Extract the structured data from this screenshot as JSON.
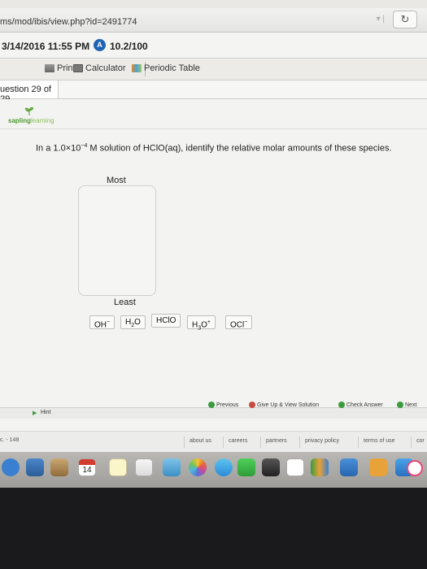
{
  "browser": {
    "url": "ms/mod/ibis/view.php?id=2491774",
    "reload_icon": "reload-icon"
  },
  "status": {
    "datetime": "3/14/2016 11:55 PM",
    "score_icon_letter": "A",
    "score": "10.2/100"
  },
  "toolbar": {
    "print_label": "Print",
    "calculator_label": "Calculator",
    "periodic_table_label": "Periodic Table"
  },
  "question_nav": {
    "label": "uestion 29 of 29"
  },
  "logo": {
    "brand": "sapling",
    "suffix": "learning"
  },
  "question": {
    "prefix": "In a 1.0×10",
    "exponent": "−4",
    "suffix": " M solution of HClO(aq), identify the relative molar amounts of these species."
  },
  "ranking": {
    "most_label": "Most",
    "least_label": "Least"
  },
  "species": [
    {
      "base": "OH",
      "sub": "",
      "sup": "−"
    },
    {
      "base": "H",
      "sub": "2",
      "sup": "",
      "tail": "O"
    },
    {
      "base": "HClO",
      "sub": "",
      "sup": ""
    },
    {
      "base": "H",
      "sub": "3",
      "sup": "+",
      "tail": "O"
    },
    {
      "base": "OCl",
      "sub": "",
      "sup": "−"
    }
  ],
  "actions": {
    "previous": "Previous",
    "give_up": "Give Up & View Solution",
    "check_answer": "Check Answer",
    "next": "Next"
  },
  "hint": {
    "label": "Hint"
  },
  "footer": {
    "left_text": "c. - 148",
    "links": [
      "about us",
      "careers",
      "partners",
      "privacy policy",
      "terms of use",
      "cor"
    ]
  },
  "dock": {
    "calendar_day": "14",
    "calendar_month": "MAR"
  },
  "colors": {
    "accent_green": "#3b9b3e",
    "score_blue": "#1f63b3",
    "give_up_red": "#c94a3f"
  }
}
